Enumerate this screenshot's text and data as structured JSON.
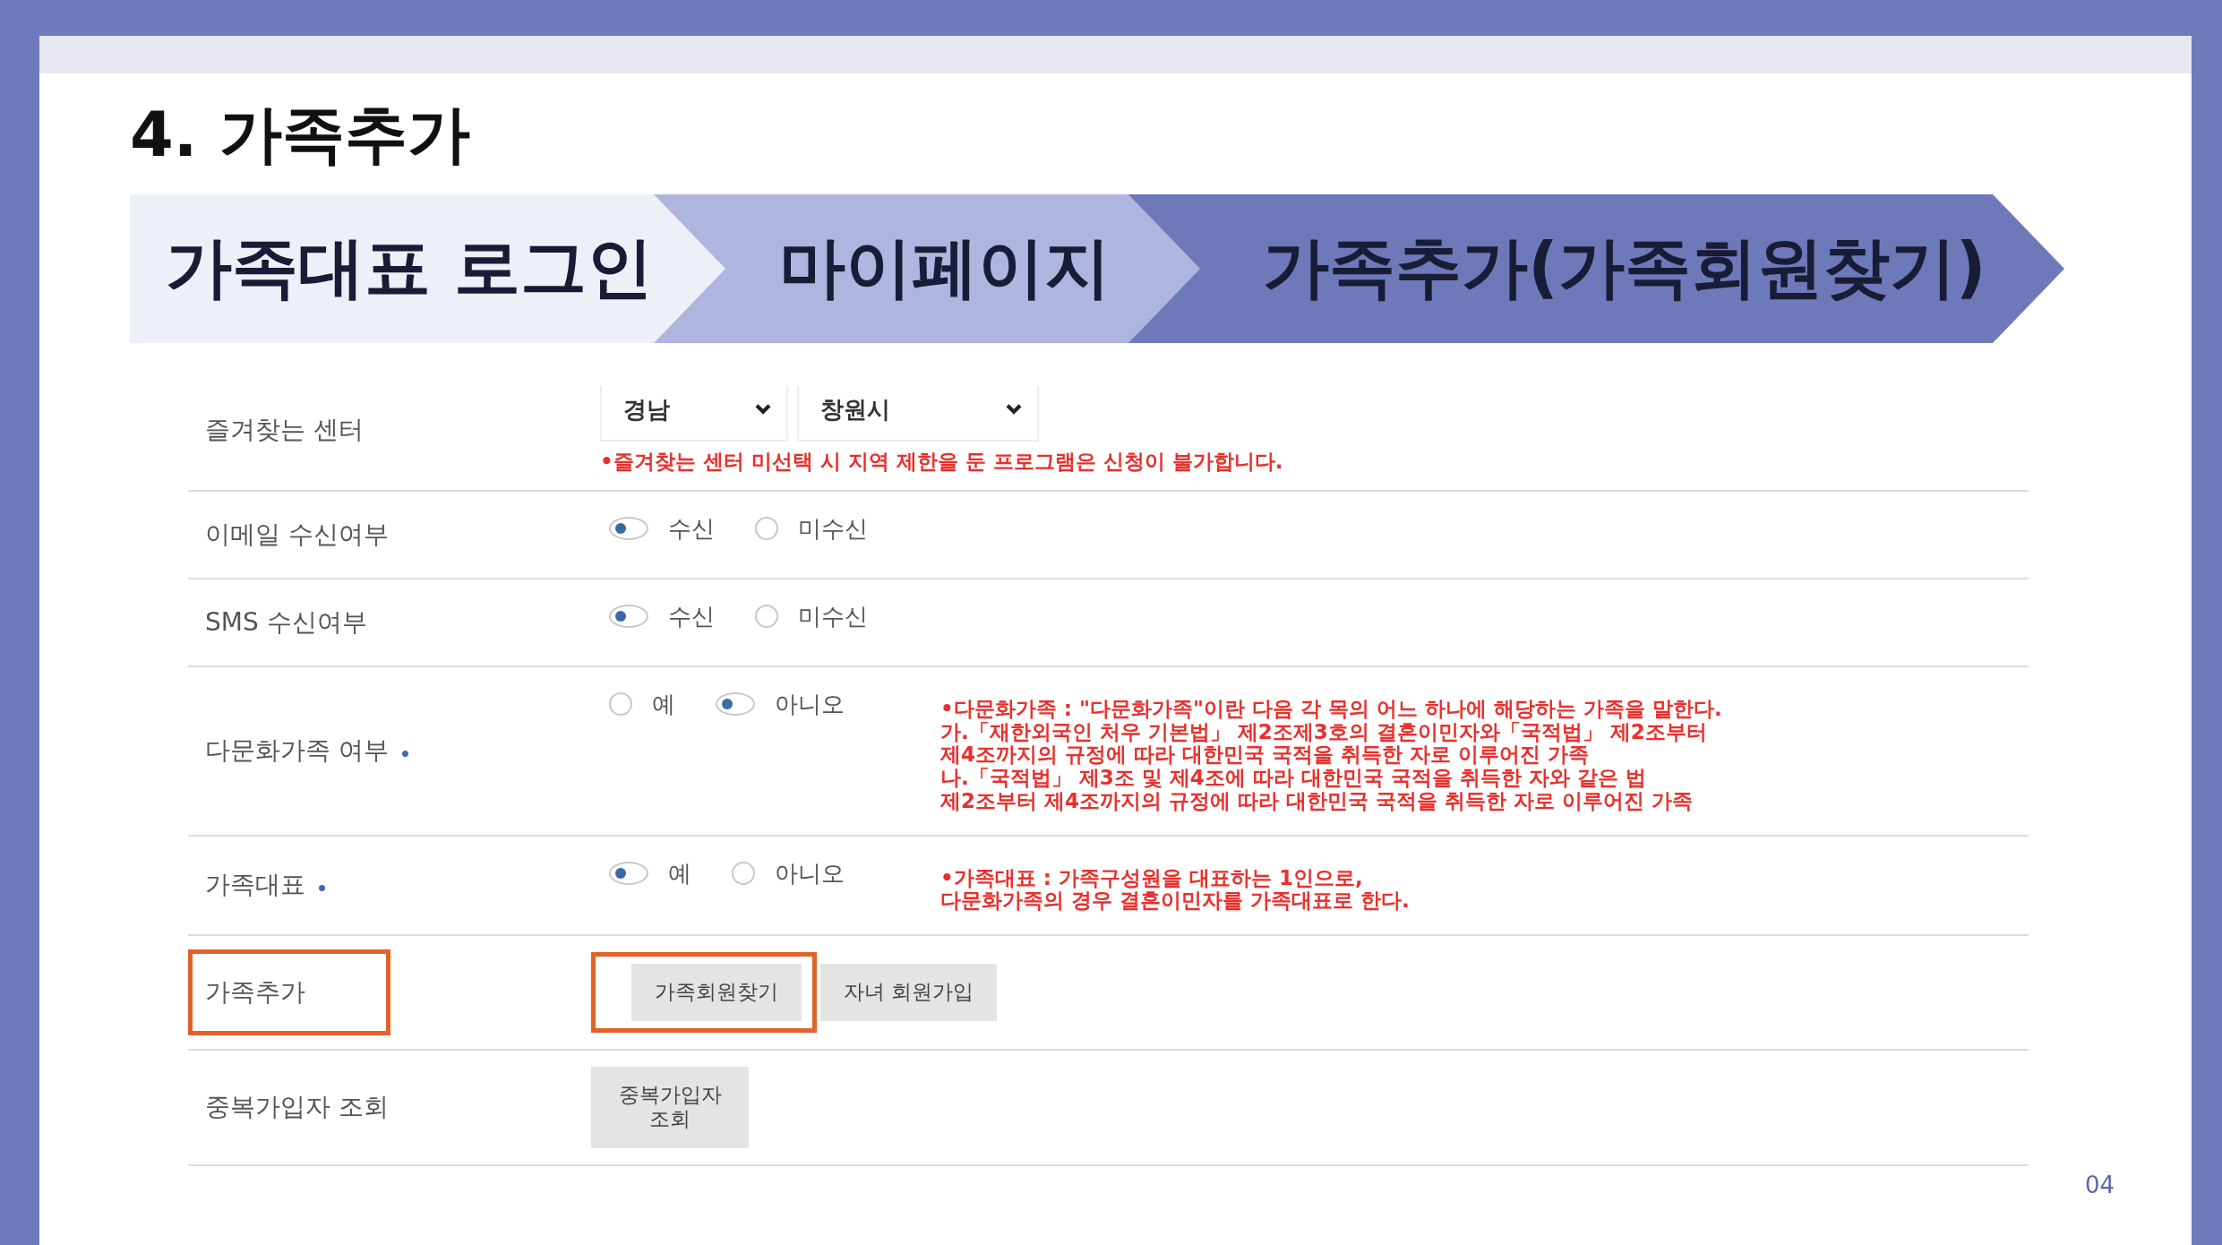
{
  "title": "4. 가족추가",
  "steps": [
    {
      "label": "가족대표 로그인",
      "color": "#eef0f7"
    },
    {
      "label": "마이페이지",
      "color": "#aeb6e0"
    },
    {
      "label": "가족추가(가족회원찾기)",
      "color": "#6d79b9"
    }
  ],
  "form": {
    "rows": [
      {
        "kind": "selects",
        "label": "즐겨찾는 센터",
        "selects": [
          {
            "value": "경남"
          },
          {
            "value": "창원시"
          }
        ],
        "note": "•즐겨찾는 센터 미선택 시 지역 제한을 둔 프로그램은 신청이 불가합니다."
      },
      {
        "kind": "radios",
        "label": "이메일 수신여부",
        "options": [
          {
            "label": "수신",
            "selected": true
          },
          {
            "label": "미수신",
            "selected": false
          }
        ]
      },
      {
        "kind": "radios",
        "label": "SMS 수신여부",
        "options": [
          {
            "label": "수신",
            "selected": true
          },
          {
            "label": "미수신",
            "selected": false
          }
        ]
      },
      {
        "kind": "radios",
        "label": "다문화가족 여부",
        "required": true,
        "options": [
          {
            "label": "예",
            "selected": false
          },
          {
            "label": "아니오",
            "selected": true
          }
        ],
        "note": "•다문화가족 : \"다문화가족\"이란 다음 각 목의 어느 하나에 해당하는 가족을 말한다.\n가.「재한외국인 처우 기본법」 제2조제3호의 결혼이민자와「국적법」 제2조부터\n제4조까지의 규정에 따라 대한민국 국적을 취득한 자로 이루어진 가족\n나.「국적법」 제3조 및 제4조에 따라 대한민국 국적을 취득한 자와 같은 법\n제2조부터 제4조까지의 규정에 따라 대한민국 국적을 취득한 자로 이루어진 가족"
      },
      {
        "kind": "radios",
        "label": "가족대표",
        "required": true,
        "options": [
          {
            "label": "예",
            "selected": true
          },
          {
            "label": "아니오",
            "selected": false
          }
        ],
        "note": "•가족대표 : 가족구성원을 대표하는 1인으로,\n다문화가족의 경우 결혼이민자를 가족대표로 한다."
      },
      {
        "kind": "buttons",
        "label": "가족추가",
        "highlighted": true,
        "buttons": [
          {
            "label": "가족회원찾기",
            "highlighted": true
          },
          {
            "label": "자녀 회원가입"
          }
        ]
      },
      {
        "kind": "buttons",
        "label": "중복가입자 조회",
        "buttons": [
          {
            "label": "중복가입자\n조회"
          }
        ]
      }
    ]
  },
  "page_number": "04"
}
